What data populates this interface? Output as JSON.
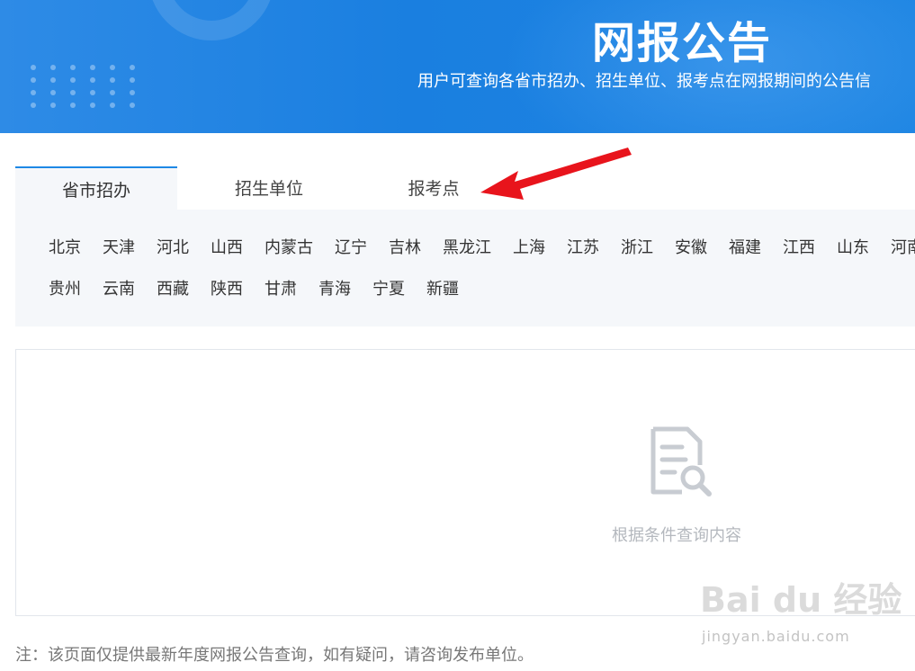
{
  "banner": {
    "title": "网报公告",
    "subtitle": "用户可查询各省市招办、招生单位、报考点在网报期间的公告信"
  },
  "tabs": [
    {
      "label": "省市招办",
      "active": true
    },
    {
      "label": "招生单位",
      "active": false
    },
    {
      "label": "报考点",
      "active": false
    }
  ],
  "provinces": {
    "row1": [
      "北京",
      "天津",
      "河北",
      "山西",
      "内蒙古",
      "辽宁",
      "吉林",
      "黑龙江",
      "上海",
      "江苏",
      "浙江",
      "安徽",
      "福建",
      "江西",
      "山东",
      "河南"
    ],
    "row2": [
      "贵州",
      "云南",
      "西藏",
      "陕西",
      "甘肃",
      "青海",
      "宁夏",
      "新疆"
    ]
  },
  "results": {
    "empty_icon": "document-search-icon",
    "empty_text": "根据条件查询内容"
  },
  "note": "注：该页面仅提供最新年度网报公告查询，如有疑问，请咨询发布单位。",
  "watermark": {
    "main": "Bai du 经验",
    "sub": "jingyan.baidu.com"
  },
  "colors": {
    "banner_blue": "#1a7fe0",
    "tab_active_border": "#1e88e5",
    "panel_bg": "#f5f7fa",
    "annotation_arrow": "#e8141c"
  }
}
